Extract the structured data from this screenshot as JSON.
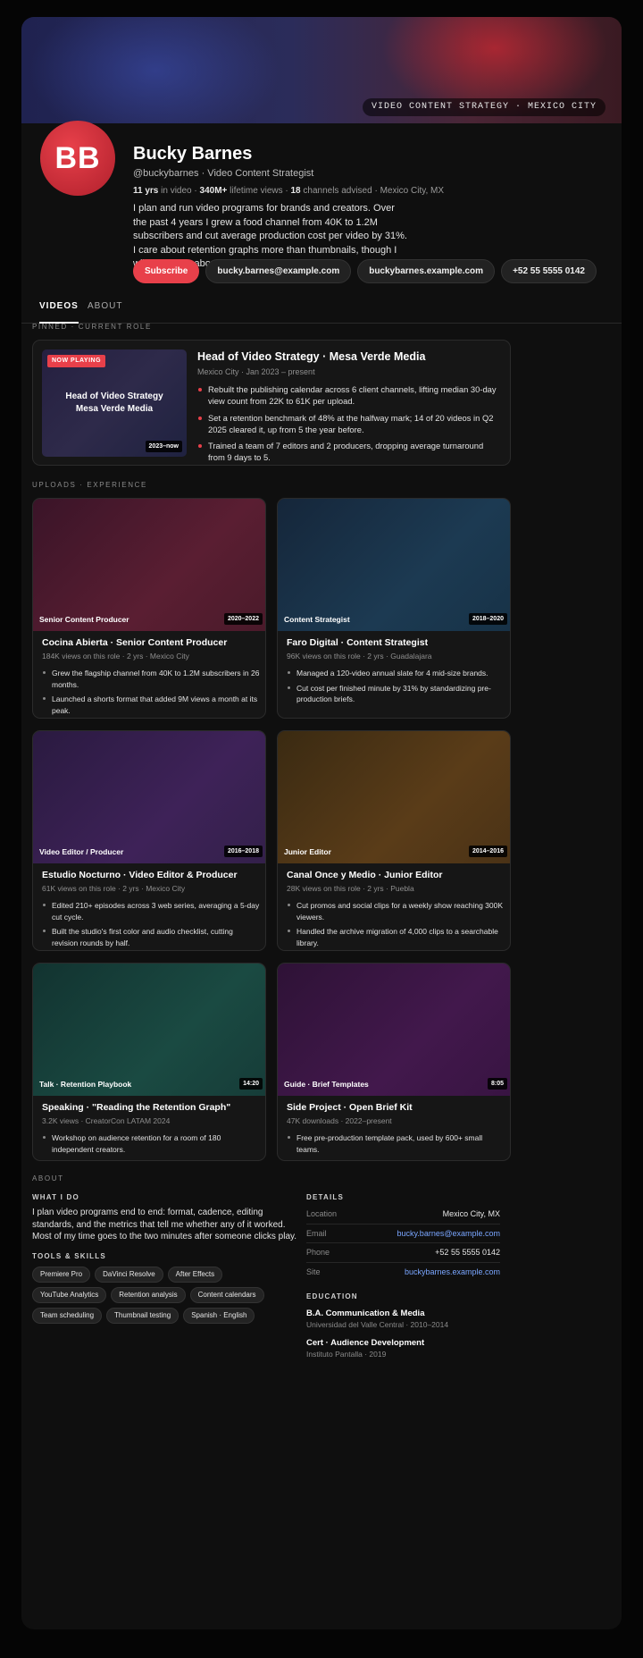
{
  "banner": {
    "tag": "VIDEO CONTENT STRATEGY · MEXICO CITY"
  },
  "profile": {
    "initials": "BB",
    "name": "Bucky Barnes",
    "handle": "@buckybarnes · Video Content Strategist",
    "stats": {
      "years_value": "11 yrs",
      "years_label": " in video · ",
      "views_value": "340M+",
      "views_label": " lifetime views · ",
      "channels_value": "18",
      "channels_label": " channels advised · Mexico City, MX"
    },
    "bio": "I plan and run video programs for brands and creators. Over the past 4 years I grew a food channel from 40K to 1.2M subscribers and cut average production cost per video by 31%. I care about retention graphs more than thumbnails, though I will still argue about a thumbnail for an hour."
  },
  "actions": {
    "subscribe": "Subscribe",
    "email": "bucky.barnes@example.com",
    "site": "buckybarnes.example.com",
    "phone": "+52 55 5555 0142"
  },
  "tabs": [
    "VIDEOS",
    "ABOUT"
  ],
  "pinned": {
    "section_label": "PINNED · CURRENT ROLE",
    "badge": "NOW PLAYING",
    "thumb_title_1": "Head of Video Strategy",
    "thumb_title_2": "Mesa Verde Media",
    "duration": "2023–now",
    "title": "Head of Video Strategy · Mesa Verde Media",
    "meta": "Mexico City · Jan 2023 – present",
    "bullets": [
      "Rebuilt the publishing calendar across 6 client channels, lifting median 30-day view count from 22K to 61K per upload.",
      "Set a retention benchmark of 48% at the halfway mark; 14 of 20 videos in Q2 2025 cleared it, up from 5 the year before.",
      "Trained a team of 7 editors and 2 producers, dropping average turnaround from 9 days to 5."
    ]
  },
  "uploads": {
    "section_label": "UPLOADS · EXPERIENCE",
    "cards": [
      {
        "thumb_label": "Senior Content Producer",
        "duration": "2020–2022",
        "title": "Cocina Abierta · Senior Content Producer",
        "meta": "184K views on this role · 2 yrs · Mexico City",
        "bullets": [
          "Grew the flagship channel from 40K to 1.2M subscribers in 26 months.",
          "Launched a shorts format that added 9M views a month at its peak."
        ]
      },
      {
        "thumb_label": "Content Strategist",
        "duration": "2018–2020",
        "title": "Faro Digital · Content Strategist",
        "meta": "96K views on this role · 2 yrs · Guadalajara",
        "bullets": [
          "Managed a 120-video annual slate for 4 mid-size brands.",
          "Cut cost per finished minute by 31% by standardizing pre-production briefs."
        ]
      },
      {
        "thumb_label": "Video Editor / Producer",
        "duration": "2016–2018",
        "title": "Estudio Nocturno · Video Editor & Producer",
        "meta": "61K views on this role · 2 yrs · Mexico City",
        "bullets": [
          "Edited 210+ episodes across 3 web series, averaging a 5-day cut cycle.",
          "Built the studio's first color and audio checklist, cutting revision rounds by half."
        ]
      },
      {
        "thumb_label": "Junior Editor",
        "duration": "2014–2016",
        "title": "Canal Once y Medio · Junior Editor",
        "meta": "28K views on this role · 2 yrs · Puebla",
        "bullets": [
          "Cut promos and social clips for a weekly show reaching 300K viewers.",
          "Handled the archive migration of 4,000 clips to a searchable library."
        ]
      },
      {
        "thumb_label": "Talk · Retention Playbook",
        "duration": "14:20",
        "title": "Speaking · \"Reading the Retention Graph\"",
        "meta": "3.2K views · CreatorCon LATAM 2024",
        "bullets": [
          "Workshop on audience retention for a room of 180 independent creators."
        ]
      },
      {
        "thumb_label": "Guide · Brief Templates",
        "duration": "8:05",
        "title": "Side Project · Open Brief Kit",
        "meta": "47K downloads · 2022–present",
        "bullets": [
          "Free pre-production template pack, used by 600+ small teams."
        ]
      }
    ]
  },
  "about": {
    "section_label": "ABOUT",
    "what_heading": "WHAT I DO",
    "what_text": "I plan video programs end to end: format, cadence, editing standards, and the metrics that tell me whether any of it worked. Most of my time goes to the two minutes after someone clicks play.",
    "skills_heading": "TOOLS & SKILLS",
    "skills": [
      "Premiere Pro",
      "DaVinci Resolve",
      "After Effects",
      "YouTube Analytics",
      "Retention analysis",
      "Content calendars",
      "Team scheduling",
      "Thumbnail testing",
      "Spanish · English"
    ],
    "details_heading": "DETAILS",
    "details": [
      {
        "key": "Location",
        "value": "Mexico City, MX"
      },
      {
        "key": "Email",
        "value": "bucky.barnes@example.com"
      },
      {
        "key": "Phone",
        "value": "+52 55 5555 0142"
      },
      {
        "key": "Site",
        "value": "buckybarnes.example.com"
      }
    ],
    "education_heading": "EDUCATION",
    "education": [
      {
        "title": "B.A. Communication & Media",
        "meta": "Universidad del Valle Central · 2010–2014"
      },
      {
        "title": "Cert · Audience Development",
        "meta": "Instituto Pantalla · 2019"
      }
    ]
  },
  "colors": {
    "accent": "#e8404a",
    "link": "#7aa6ff",
    "background": "#0f0f0f"
  }
}
